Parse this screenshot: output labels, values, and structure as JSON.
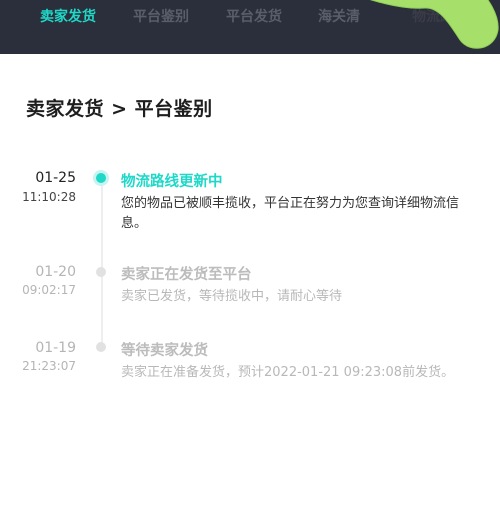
{
  "tabs": [
    {
      "label": "卖家发货",
      "active": true
    },
    {
      "label": "平台鉴别",
      "active": false
    },
    {
      "label": "平台发货",
      "active": false
    },
    {
      "label": "海关清",
      "active": false
    },
    {
      "label": "物流跟踪",
      "active": false
    }
  ],
  "breadcrumb": "卖家发货 > 平台鉴别",
  "timeline": [
    {
      "date": "01-25",
      "time": "11:10:28",
      "title": "物流路线更新中",
      "desc": "您的物品已被顺丰揽收，平台正在努力为您查询详细物流信息。",
      "current": true
    },
    {
      "date": "01-20",
      "time": "09:02:17",
      "title": "卖家正在发货至平台",
      "desc": "卖家已发货，等待揽收中，请耐心等待",
      "current": false
    },
    {
      "date": "01-19",
      "time": "21:23:07",
      "title": "等待卖家发货",
      "desc": "卖家正在准备发货，预计2022-01-21 09:23:08前发货。",
      "current": false
    }
  ],
  "colors": {
    "accent": "#1ed8c8",
    "topbar": "#2b2e3b",
    "sticker": "#a6e06a"
  }
}
